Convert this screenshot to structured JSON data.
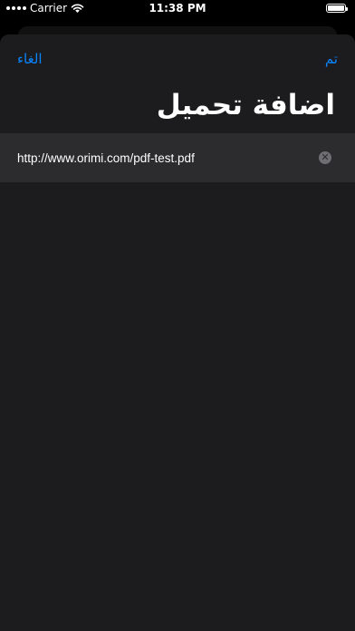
{
  "status_bar": {
    "carrier": "Carrier",
    "time": "11:38 PM",
    "battery_level": 1.0
  },
  "nav": {
    "cancel_label": "الغاء",
    "done_label": "تم"
  },
  "title": "اضافة تحميل",
  "url_field": {
    "value": "http://www.orimi.com/pdf-test.pdf",
    "placeholder": ""
  },
  "icons": {
    "clear": "clear-circle-icon",
    "wifi": "wifi-icon",
    "battery": "battery-icon"
  },
  "colors": {
    "accent": "#0a84ff",
    "sheet_background": "#1c1c1e",
    "field_background": "#2c2c2e"
  }
}
